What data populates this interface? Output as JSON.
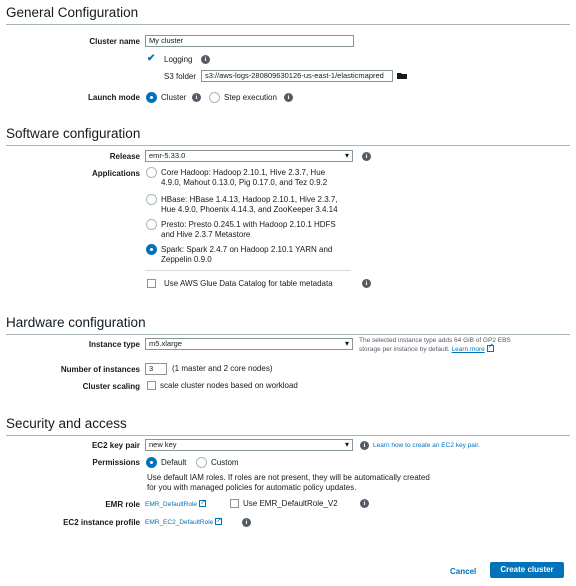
{
  "general": {
    "title": "General Configuration",
    "cluster_name_label": "Cluster name",
    "cluster_name_value": "My cluster",
    "logging_label": "Logging",
    "logging_checked": true,
    "s3_folder_label": "S3 folder",
    "s3_folder_value": "s3://aws-logs-280809630126-us-east-1/elasticmapred",
    "launch_mode_label": "Launch mode",
    "launch_mode_options": [
      "Cluster",
      "Step execution"
    ],
    "launch_mode_selected": "Cluster"
  },
  "software": {
    "title": "Software configuration",
    "release_label": "Release",
    "release_value": "emr-5.33.0",
    "applications_label": "Applications",
    "applications": [
      {
        "line1": "Core Hadoop: Hadoop 2.10.1, Hive 2.3.7, Hue",
        "line2": "4.9.0, Mahout 0.13.0, Pig 0.17.0, and Tez 0.9.2",
        "selected": false
      },
      {
        "line1": "HBase: HBase 1.4.13, Hadoop 2.10.1, Hive 2.3.7,",
        "line2": "Hue 4.9.0, Phoenix 4.14.3, and ZooKeeper 3.4.14",
        "selected": false
      },
      {
        "line1": "Presto: Presto 0.245.1 with Hadoop 2.10.1 HDFS",
        "line2": "and Hive 2.3.7 Metastore",
        "selected": false
      },
      {
        "line1": "Spark: Spark 2.4.7 on Hadoop 2.10.1 YARN and",
        "line2": "Zeppelin 0.9.0",
        "selected": true
      }
    ],
    "glue_label": "Use AWS Glue Data Catalog for table metadata"
  },
  "hardware": {
    "title": "Hardware configuration",
    "instance_type_label": "Instance type",
    "instance_type_value": "m5.xlarge",
    "instance_note_line1": "The selected instance type adds 64 GiB of GP2 EBS",
    "instance_note_line2": "storage per instance by default.",
    "learn_more": "Learn more",
    "num_instances_label": "Number of instances",
    "num_instances_value": "3",
    "num_instances_note": "(1 master and 2 core nodes)",
    "cluster_scaling_label": "Cluster scaling",
    "cluster_scaling_text": "scale cluster nodes based on workload"
  },
  "security": {
    "title": "Security and access",
    "key_pair_label": "EC2 key pair",
    "key_pair_value": "new key",
    "key_pair_link": "Learn how to create an EC2 key pair.",
    "permissions_label": "Permissions",
    "permissions_options": [
      "Default",
      "Custom"
    ],
    "permissions_selected": "Default",
    "permissions_note_line1": "Use default IAM roles. If roles are not present, they will be automatically created",
    "permissions_note_line2": "for you with managed policies for automatic policy updates.",
    "emr_role_label": "EMR role",
    "emr_role_value": "EMR_DefaultRole",
    "emr_role_v2_label": "Use EMR_DefaultRole_V2",
    "ec2_profile_label": "EC2 instance profile",
    "ec2_profile_value": "EMR_EC2_DefaultRole"
  },
  "footer": {
    "cancel_label": "Cancel",
    "create_label": "Create cluster"
  },
  "colors": {
    "accent": "#0073bb",
    "rule": "#aab7b8"
  }
}
